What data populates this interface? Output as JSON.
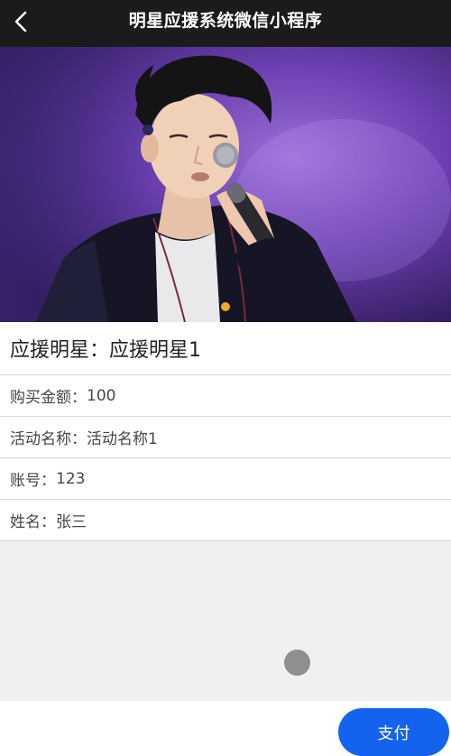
{
  "header": {
    "title": "明星应援系统微信小程序",
    "back_icon": "chevron-left-icon"
  },
  "hero": {
    "image": "singer-photo"
  },
  "detail": {
    "star_label": "应援明星：",
    "star_value": "应援明星1",
    "amount_label": "购买金额：",
    "amount_value": "100",
    "activity_label": "活动名称：",
    "activity_value": "活动名称1",
    "account_label": "账号：",
    "account_value": "123",
    "name_label": "姓名：",
    "name_value": "张三"
  },
  "footer": {
    "pay_label": "支付"
  },
  "colors": {
    "header_bg": "#1b1b1d",
    "accent": "#1463ef",
    "page_bg": "#f0f0f0"
  }
}
